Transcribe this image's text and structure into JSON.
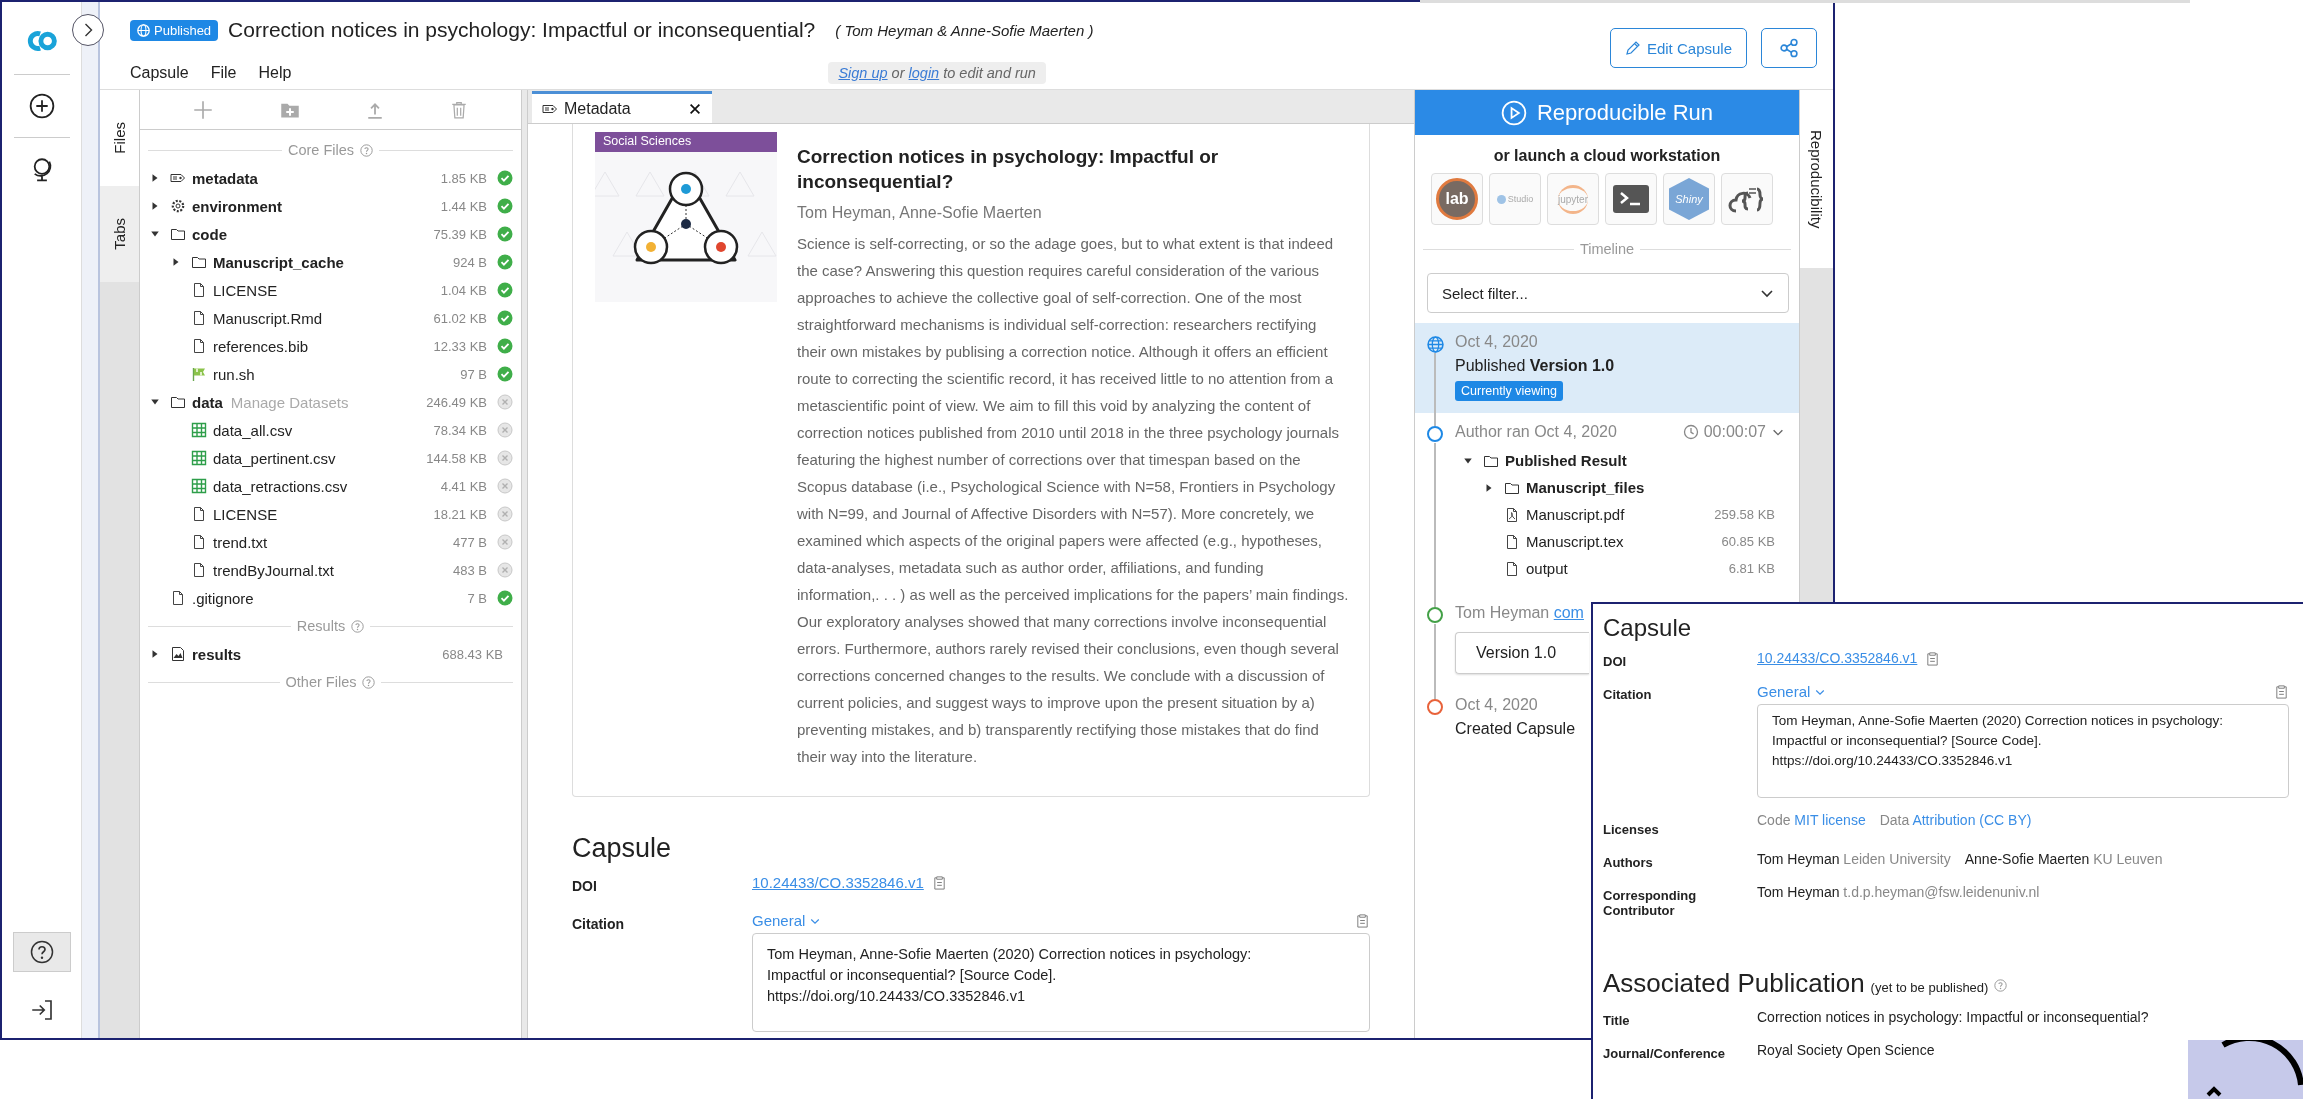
{
  "header": {
    "status_badge": "Published",
    "title": "Correction notices in psychology: Impactful or inconsequential?",
    "authors": "( Tom Heyman & Anne-Sofie Maerten )",
    "menu": [
      "Capsule",
      "File",
      "Help"
    ],
    "notice": {
      "signup": "Sign up",
      "or": "or",
      "login": "login",
      "rest": "to edit and run"
    },
    "edit_button": "Edit Capsule"
  },
  "side_tabs": [
    {
      "label": "Files",
      "selected": true
    },
    {
      "label": "Tabs",
      "selected": false
    }
  ],
  "file_tree": [
    {
      "kind": "section",
      "label": "Core Files"
    },
    {
      "kind": "metadata",
      "name": "metadata",
      "size": "1.85 KB",
      "synced": true,
      "expanded": false
    },
    {
      "kind": "environment",
      "name": "environment",
      "size": "1.44 KB",
      "synced": true,
      "expanded": false
    },
    {
      "kind": "folder",
      "name": "code",
      "size": "75.39 KB",
      "synced": true,
      "expanded": true,
      "children": [
        {
          "kind": "folder",
          "name": "Manuscript_cache",
          "size": "924 B",
          "synced": true,
          "expanded": false
        },
        {
          "kind": "file",
          "name": "LICENSE",
          "size": "1.04 KB",
          "synced": true
        },
        {
          "kind": "file",
          "name": "Manuscript.Rmd",
          "size": "61.02 KB",
          "synced": true
        },
        {
          "kind": "file",
          "name": "references.bib",
          "size": "12.33 KB",
          "synced": true
        },
        {
          "kind": "script",
          "name": "run.sh",
          "size": "97 B",
          "synced": true
        }
      ]
    },
    {
      "kind": "folder",
      "name": "data",
      "note": "Manage Datasets",
      "size": "246.49 KB",
      "synced": false,
      "expanded": true,
      "children": [
        {
          "kind": "table",
          "name": "data_all.csv",
          "size": "78.34 KB",
          "synced": false
        },
        {
          "kind": "table",
          "name": "data_pertinent.csv",
          "size": "144.58 KB",
          "synced": false
        },
        {
          "kind": "table",
          "name": "data_retractions.csv",
          "size": "4.41 KB",
          "synced": false
        },
        {
          "kind": "file",
          "name": "LICENSE",
          "size": "18.21 KB",
          "synced": false
        },
        {
          "kind": "file",
          "name": "trend.txt",
          "size": "477 B",
          "synced": false
        },
        {
          "kind": "file",
          "name": "trendByJournal.txt",
          "size": "483 B",
          "synced": false
        }
      ]
    },
    {
      "kind": "file",
      "name": ".gitignore",
      "size": "7 B",
      "synced": true
    },
    {
      "kind": "section",
      "label": "Results"
    },
    {
      "kind": "results",
      "name": "results",
      "size": "688.43 KB",
      "expanded": false
    },
    {
      "kind": "section",
      "label": "Other Files"
    }
  ],
  "editor": {
    "tabs": [
      {
        "label": "Metadata",
        "selected": true
      }
    ],
    "card": {
      "category": "Social Sciences",
      "title": "Correction notices in psychology: Impactful or inconsequential?",
      "authors": "Tom Heyman, Anne-Sofie Maerten",
      "abstract": "Science is self-correcting, or so the adage goes, but to what extent is that indeed the case? Answering this question requires careful consideration of the various approaches to achieve the collective goal of self-correction. One of the most straightforward mechanisms is individual self-correction: researchers rectifying their own mistakes by publising a correction notice. Although it offers an efficient route to correcting the scientific record, it has received little to no attention from a metascientific point of view. We aim to fill this void by analyzing the content of correction notices published from 2010 until 2018 in the three psychology journals featuring the highest number of corrections over that timespan based on the Scopus database (i.e., Psychological Science with N=58, Frontiers in Psychology with N=99, and Journal of Affective Disorders with N=57). More concretely, we examined which aspects of the original papers were affected (e.g., hypotheses, data-analyses, metadata such as author order, affiliations, and funding information,. . . ) as well as the perceived implications for the papers’ main findings. Our exploratory analyses showed that many corrections involve inconsequential errors. Furthermore, authors rarely revised their conclusions, even though several corrections concerned changes to the results. We conclude with a discussion of current policies, and suggest ways to improve upon the present situation by a) preventing mistakes, and b) transparently rectifying those mistakes that do find their way into the literature."
    },
    "capsule": {
      "heading": "Capsule",
      "doi_label": "DOI",
      "doi": "10.24433/CO.3352846.v1",
      "citation_label": "Citation",
      "citation_style": "General",
      "citation": "Tom Heyman, Anne-Sofie Maerten (2020) Correction notices in psychology:\nImpactful or inconsequential? [Source Code].\nhttps://doi.org/10.24433/CO.3352846.v1"
    }
  },
  "reproducibility": {
    "run_button": "Reproducible Run",
    "launch_label": "or launch a cloud workstation",
    "tools": [
      {
        "kind": "lab",
        "label": "lab"
      },
      {
        "kind": "rstudio",
        "label": "Studio"
      },
      {
        "kind": "jupyter",
        "label": "jupyter"
      },
      {
        "kind": "terminal"
      },
      {
        "kind": "shiny",
        "label": "Shiny"
      },
      {
        "kind": "cloud"
      }
    ],
    "timeline_label": "Timeline",
    "filter": {
      "placeholder": "Select filter..."
    },
    "timeline": [
      {
        "kind": "published",
        "color": "#1e88e5",
        "date": "Oct 4, 2020",
        "text": "Published **Version 1.0**",
        "badge": "Currently viewing",
        "selected": true
      },
      {
        "kind": "run",
        "color": "#1e88e5",
        "text": "Author ran Oct 4, 2020",
        "duration": "00:00:07",
        "expanded": true,
        "selected": false,
        "results": [
          {
            "kind": "folder",
            "name": "Published Result",
            "expanded": true,
            "children": [
              {
                "kind": "folder",
                "name": "Manuscript_files",
                "expanded": false
              },
              {
                "kind": "pdf",
                "name": "Manuscript.pdf",
                "size": "259.58 KB"
              },
              {
                "kind": "file",
                "name": "Manuscript.tex",
                "size": "60.85 KB"
              },
              {
                "kind": "file",
                "name": "output",
                "size": "6.81 KB"
              }
            ]
          }
        ]
      },
      {
        "kind": "comment",
        "color": "#43a047",
        "author": "Tom Heyman",
        "link": "com",
        "version": "Version 1.0",
        "selected": false
      },
      {
        "kind": "created",
        "color": "#e8623a",
        "date": "Oct 4, 2020",
        "text": "Created Capsule",
        "selected": false
      }
    ],
    "side_tab": {
      "label": "Reproducibility",
      "selected": true
    }
  },
  "capsule_card": {
    "heading": "Capsule",
    "doi_label": "DOI",
    "doi": "10.24433/CO.3352846.v1",
    "citation_label": "Citation",
    "citation_style": "General",
    "citation": "Tom Heyman, Anne-Sofie Maerten (2020) Correction notices in psychology:\nImpactful or inconsequential? [Source Code].\nhttps://doi.org/10.24433/CO.3352846.v1",
    "licenses_label": "Licenses",
    "licenses": [
      {
        "type": "Code",
        "name": "MIT license"
      },
      {
        "type": "Data",
        "name": "Attribution (CC BY)"
      }
    ],
    "authors_label": "Authors",
    "authors": [
      {
        "name": "Tom Heyman",
        "affiliation": "Leiden University"
      },
      {
        "name": "Anne-Sofie Maerten",
        "affiliation": "KU Leuven"
      }
    ],
    "contact_label": "Corresponding Contributor",
    "contact": {
      "name": "Tom Heyman",
      "email": "t.d.p.heyman@fsw.leidenuniv.nl"
    },
    "publication_heading": "Associated Publication",
    "publication_note": "(yet to be published)",
    "publication": [
      {
        "label": "Title",
        "value": "Correction notices in psychology: Impactful or inconsequential?"
      },
      {
        "label": "Journal/Conference",
        "value": "Royal Society Open Science"
      }
    ]
  }
}
